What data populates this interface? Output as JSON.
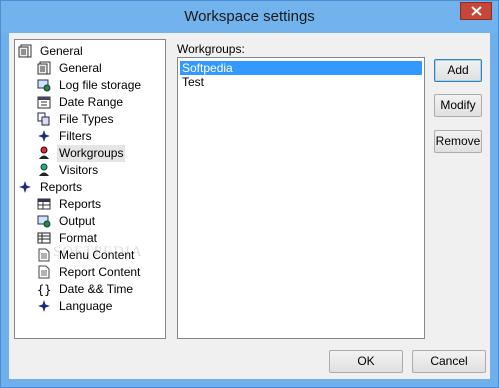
{
  "window": {
    "title": "Workspace settings"
  },
  "tree": {
    "items": [
      {
        "label": "General",
        "icon": "settings-sheet-icon",
        "level": 0
      },
      {
        "label": "General",
        "icon": "settings-sheet-icon",
        "level": 1
      },
      {
        "label": "Log file storage",
        "icon": "storage-icon",
        "level": 1
      },
      {
        "label": "Date Range",
        "icon": "calendar-icon",
        "level": 1
      },
      {
        "label": "File Types",
        "icon": "file-types-icon",
        "level": 1
      },
      {
        "label": "Filters",
        "icon": "filter-star-icon",
        "level": 1
      },
      {
        "label": "Workgroups",
        "icon": "workgroups-user-icon",
        "level": 1,
        "selected": true
      },
      {
        "label": "Visitors",
        "icon": "visitor-user-icon",
        "level": 1
      },
      {
        "label": "Reports",
        "icon": "reports-star-icon",
        "level": 0
      },
      {
        "label": "Reports",
        "icon": "report-table-icon",
        "level": 1
      },
      {
        "label": "Output",
        "icon": "output-icon",
        "level": 1
      },
      {
        "label": "Format",
        "icon": "format-table-icon",
        "level": 1
      },
      {
        "label": "Menu Content",
        "icon": "document-icon",
        "level": 1
      },
      {
        "label": "Report Content",
        "icon": "document-icon",
        "level": 1
      },
      {
        "label": "Date && Time",
        "icon": "braces-icon",
        "level": 1
      },
      {
        "label": "Language",
        "icon": "language-star-icon",
        "level": 1
      }
    ]
  },
  "workgroups": {
    "label": "Workgroups:",
    "items": [
      {
        "label": "Softpedia",
        "selected": true
      },
      {
        "label": "Test",
        "selected": false
      }
    ]
  },
  "buttons": {
    "add": "Add",
    "modify": "Modify",
    "remove": "Remove",
    "ok": "OK",
    "cancel": "Cancel"
  },
  "watermark": "SOFTPEDIA",
  "colors": {
    "titlebar": "#72b3ee",
    "selection": "#3399ff",
    "close": "#c7463a"
  }
}
